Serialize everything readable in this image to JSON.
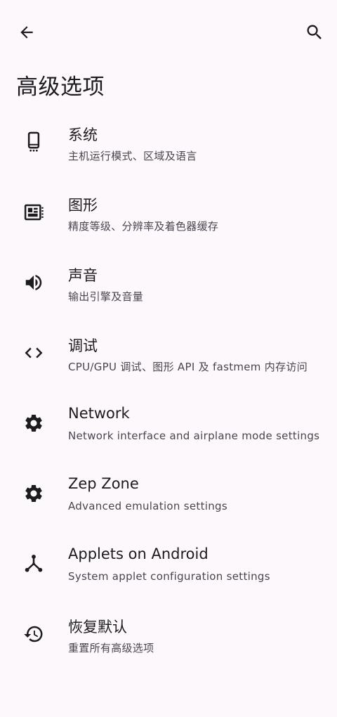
{
  "header": {
    "back_icon": "arrow-back-icon",
    "search_icon": "search-icon",
    "title": "高级选项"
  },
  "items": [
    {
      "icon": "phone-icon",
      "title": "系统",
      "summary": "主机运行模式、区域及语言"
    },
    {
      "icon": "graphics-icon",
      "title": "图形",
      "summary": "精度等级、分辨率及着色器缓存"
    },
    {
      "icon": "volume-icon",
      "title": "声音",
      "summary": "输出引擎及音量"
    },
    {
      "icon": "code-icon",
      "title": "调试",
      "summary": "CPU/GPU 调试、图形 API 及 fastmem 内存访问"
    },
    {
      "icon": "gear-icon",
      "title": "Network",
      "summary": "Network interface and airplane mode settings"
    },
    {
      "icon": "gear-icon",
      "title": "Zep Zone",
      "summary": "Advanced emulation settings"
    },
    {
      "icon": "hub-icon",
      "title": "Applets on Android",
      "summary": "System applet configuration settings"
    },
    {
      "icon": "restore-icon",
      "title": "恢复默认",
      "summary": "重置所有高级选项"
    }
  ],
  "colors": {
    "background": "#fdf8fc",
    "text_primary": "#1c1b1f",
    "text_secondary": "#49454f"
  }
}
